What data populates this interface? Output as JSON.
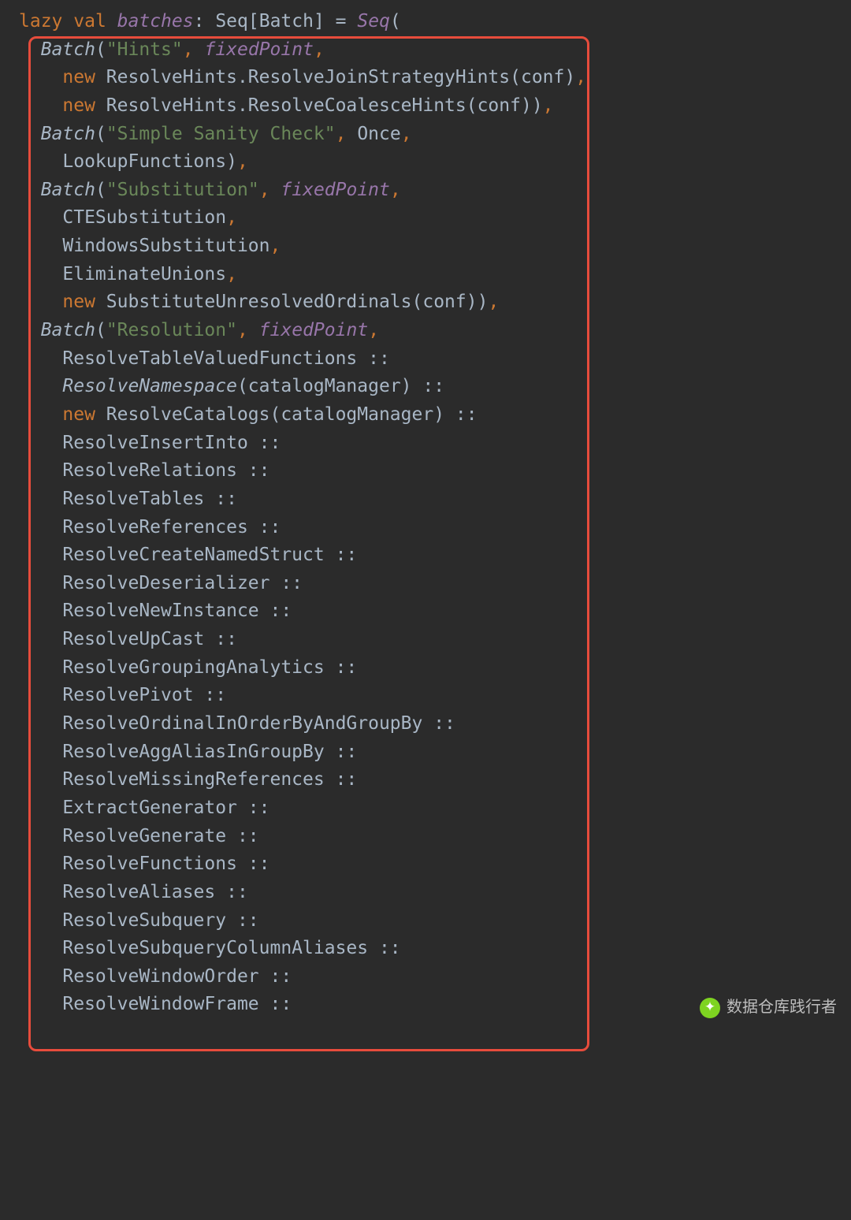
{
  "decl": {
    "lazy": "lazy",
    "val": "val",
    "name": "batches",
    "colon": ":",
    "seqType": "Seq",
    "lbr": "[",
    "batchType": "Batch",
    "rbr": "]",
    "eq": " = ",
    "seqCall": "Seq",
    "open": "("
  },
  "b1": {
    "batch": "Batch",
    "open": "(",
    "name": "\"Hints\"",
    "strat": "fixedPoint",
    "new1": "new",
    "rule1": " ResolveHints.ResolveJoinStrategyHints(conf)",
    "new2": "new",
    "rule2": " ResolveHints.ResolveCoalesceHints(conf))",
    "c": ","
  },
  "b2": {
    "batch": "Batch",
    "open": "(",
    "name": "\"Simple Sanity Check\"",
    "once": "Once",
    "rule1": "LookupFunctions)",
    "c": ","
  },
  "b3": {
    "batch": "Batch",
    "open": "(",
    "name": "\"Substitution\"",
    "strat": "fixedPoint",
    "r1": "CTESubstitution",
    "r2": "WindowsSubstitution",
    "r3": "EliminateUnions",
    "new4": "new",
    "r4": " SubstituteUnresolvedOrdinals(conf))",
    "c": ","
  },
  "b4": {
    "batch": "Batch",
    "open": "(",
    "name": "\"Resolution\"",
    "strat": "fixedPoint",
    "r01": "ResolveTableValuedFunctions ::",
    "r02a": "ResolveNamespace",
    "r02b": "(catalogManager) ::",
    "r03new": "new",
    "r03": " ResolveCatalogs(catalogManager) ::",
    "r04": "ResolveInsertInto ::",
    "r05": "ResolveRelations ::",
    "r06": "ResolveTables ::",
    "r07": "ResolveReferences ::",
    "r08": "ResolveCreateNamedStruct ::",
    "r09": "ResolveDeserializer ::",
    "r10": "ResolveNewInstance ::",
    "r11": "ResolveUpCast ::",
    "r12": "ResolveGroupingAnalytics ::",
    "r13": "ResolvePivot ::",
    "r14": "ResolveOrdinalInOrderByAndGroupBy ::",
    "r15": "ResolveAggAliasInGroupBy ::",
    "r16": "ResolveMissingReferences ::",
    "r17": "ExtractGenerator ::",
    "r18": "ResolveGenerate ::",
    "r19": "ResolveFunctions ::",
    "r20": "ResolveAliases ::",
    "r21": "ResolveSubquery ::",
    "r22": "ResolveSubqueryColumnAliases ::",
    "r23": "ResolveWindowOrder ::",
    "r24": "ResolveWindowFrame ::",
    "c": ","
  },
  "watermark": {
    "text": "数据仓库践行者"
  }
}
